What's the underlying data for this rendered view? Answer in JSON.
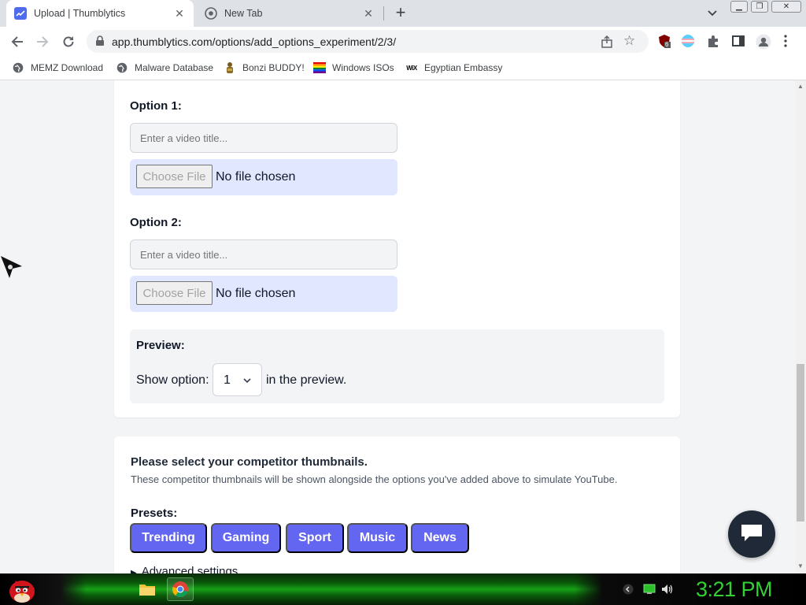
{
  "browser": {
    "tabs": [
      {
        "title": "Upload | Thumblytics",
        "active": true
      },
      {
        "title": "New Tab",
        "active": false
      }
    ],
    "url": "app.thumblytics.com/options/add_options_experiment/2/3/",
    "extension_badge": "6",
    "bookmarks": [
      {
        "label": "MEMZ Download",
        "icon": "globe-icon"
      },
      {
        "label": "Malware Database",
        "icon": "globe-icon"
      },
      {
        "label": "Bonzi BUDDY!",
        "icon": "bonzi-icon"
      },
      {
        "label": "Windows ISOs",
        "icon": "windows-flag-icon"
      },
      {
        "label": "Egyptian Embassy",
        "icon": "wix-icon"
      }
    ]
  },
  "options": [
    {
      "label": "Option 1:",
      "title_placeholder": "Enter a video title...",
      "file_button": "Choose File",
      "file_status": "No file chosen"
    },
    {
      "label": "Option 2:",
      "title_placeholder": "Enter a video title...",
      "file_button": "Choose File",
      "file_status": "No file chosen"
    }
  ],
  "preview": {
    "title": "Preview:",
    "show_prefix": "Show option:",
    "selected_option": "1",
    "show_suffix": "in the preview."
  },
  "competitors": {
    "title": "Please select your competitor thumbnails.",
    "description": "These competitor thumbnails will be shown alongside the options you've added above to simulate YouTube.",
    "presets_label": "Presets:",
    "presets": [
      "Trending",
      "Gaming",
      "Sport",
      "Music",
      "News"
    ],
    "advanced_settings": "Advanced settings"
  },
  "colors": {
    "accent": "#6366f1",
    "file_box": "#e0e7ff",
    "clock": "#31d231"
  },
  "taskbar": {
    "clock": "3:21 PM"
  }
}
